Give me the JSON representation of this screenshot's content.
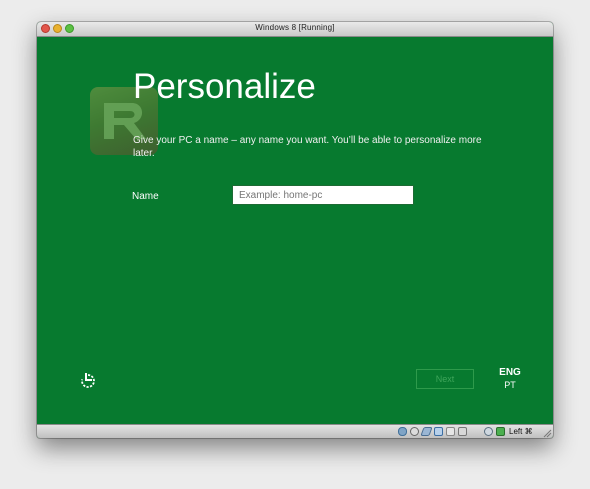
{
  "window": {
    "title": "Windows 8 [Running]"
  },
  "setup": {
    "heading": "Personalize",
    "description": "Give your PC a name – any name you want. You’ll be able to personalize more later.",
    "name_label": "Name",
    "name_placeholder": "Example: home-pc",
    "next_label": "Next",
    "language_primary": "ENG",
    "language_secondary": "PT"
  },
  "statusbar": {
    "icons": [
      "hard-disk-icon",
      "optical-drive-icon",
      "usb-icon",
      "network-icon",
      "shared-folder-icon",
      "display-icon",
      "capture-icon",
      "mouse-integration-icon"
    ],
    "host_key": "Left ⌘"
  },
  "colors": {
    "background": "#077a2f",
    "next_border": "#2e9a4b"
  }
}
